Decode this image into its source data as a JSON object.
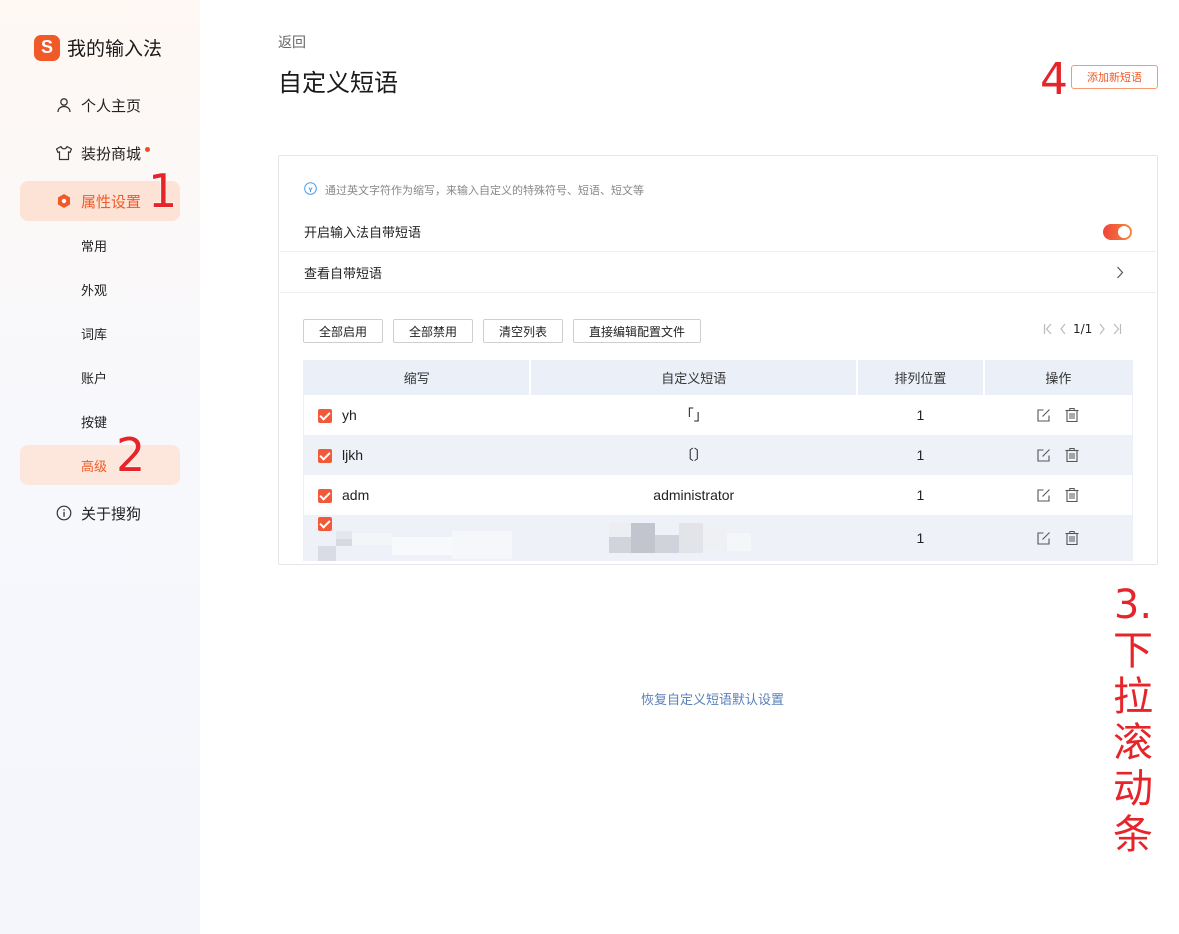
{
  "brand": {
    "logo": "S",
    "name": "我的输入法"
  },
  "sidebar": {
    "items": [
      {
        "label": "个人主页",
        "icon": "user-icon"
      },
      {
        "label": "装扮商城",
        "icon": "shirt-icon",
        "badge_dot": true
      },
      {
        "label": "属性设置",
        "icon": "hexagon-settings-icon",
        "active": true
      },
      {
        "label": "关于搜狗",
        "icon": "info-icon"
      }
    ],
    "sub_items": [
      {
        "label": "常用"
      },
      {
        "label": "外观"
      },
      {
        "label": "词库"
      },
      {
        "label": "账户"
      },
      {
        "label": "按键"
      },
      {
        "label": "高级",
        "active": true
      }
    ]
  },
  "annotations": {
    "a1": "1",
    "a2": "2",
    "a3": "3.下拉滚动条",
    "a4": "4"
  },
  "header": {
    "back": "返回",
    "title": "自定义短语",
    "add_button": "添加新短语"
  },
  "card": {
    "tip": "通过英文字符作为缩写，来输入自定义的特殊符号、短语、短文等",
    "toggle_label": "开启输入法自带短语",
    "toggle_on": true,
    "view_label": "查看自带短语",
    "buttons": {
      "enable_all": "全部启用",
      "disable_all": "全部禁用",
      "clear_list": "清空列表",
      "edit_config": "直接编辑配置文件"
    },
    "pager": {
      "text": "1/1"
    },
    "table": {
      "headers": [
        "缩写",
        "自定义短语",
        "排列位置",
        "操作"
      ],
      "rows": [
        {
          "abbr": "yh",
          "phrase": "「」",
          "position": "1",
          "checked": true
        },
        {
          "abbr": "ljkh",
          "phrase": "〔〕",
          "position": "1",
          "checked": true
        },
        {
          "abbr": "adm",
          "phrase": "administrator",
          "position": "1",
          "checked": true
        },
        {
          "abbr": "",
          "phrase": "",
          "position": "1",
          "checked": true,
          "redacted": true
        }
      ]
    }
  },
  "footer": {
    "restore": "恢复自定义短语默认设置"
  },
  "colors": {
    "accent": "#f05a28",
    "annotation": "#e5252a",
    "link": "#5a7fb8",
    "header_bg": "#ebeff8"
  }
}
